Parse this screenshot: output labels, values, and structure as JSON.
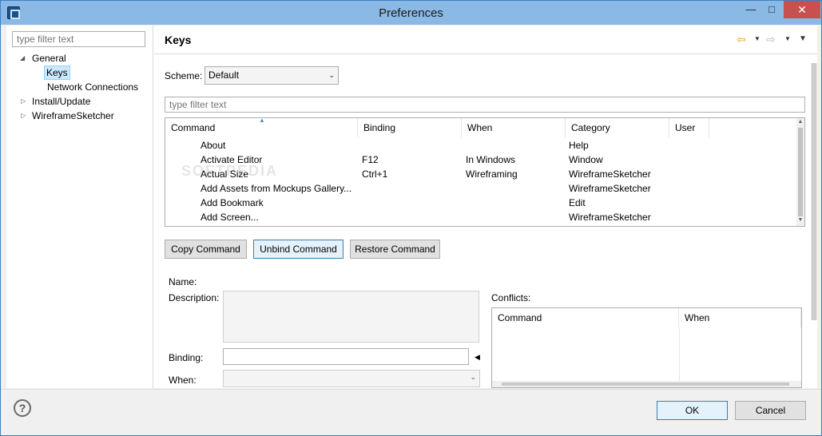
{
  "window": {
    "title": "Preferences"
  },
  "left": {
    "filter_placeholder": "type filter text",
    "tree": [
      {
        "label": "General"
      },
      {
        "label": "Keys"
      },
      {
        "label": "Network Connections"
      },
      {
        "label": "Install/Update"
      },
      {
        "label": "WireframeSketcher"
      }
    ]
  },
  "page": {
    "title": "Keys",
    "scheme_label": "Scheme:",
    "scheme_value": "Default",
    "filter_placeholder": "type filter text",
    "columns": [
      "Command",
      "Binding",
      "When",
      "Category",
      "User"
    ],
    "rows": [
      {
        "command": "About",
        "binding": "",
        "when": "",
        "category": "Help",
        "user": ""
      },
      {
        "command": "Activate Editor",
        "binding": "F12",
        "when": "In Windows",
        "category": "Window",
        "user": ""
      },
      {
        "command": "Actual Size",
        "binding": "Ctrl+1",
        "when": "Wireframing",
        "category": "WireframeSketcher",
        "user": ""
      },
      {
        "command": "Add Assets from Mockups Gallery...",
        "binding": "",
        "when": "",
        "category": "WireframeSketcher",
        "user": ""
      },
      {
        "command": "Add Bookmark",
        "binding": "",
        "when": "",
        "category": "Edit",
        "user": ""
      },
      {
        "command": "Add Screen...",
        "binding": "",
        "when": "",
        "category": "WireframeSketcher",
        "user": ""
      }
    ],
    "buttons": {
      "copy": "Copy Command",
      "unbind": "Unbind Command",
      "restore": "Restore Command"
    },
    "details": {
      "name_label": "Name:",
      "description_label": "Description:",
      "binding_label": "Binding:",
      "when_label": "When:",
      "conflicts_label": "Conflicts:",
      "conflicts_columns": [
        "Command",
        "When"
      ]
    }
  },
  "footer": {
    "ok": "OK",
    "cancel": "Cancel"
  }
}
